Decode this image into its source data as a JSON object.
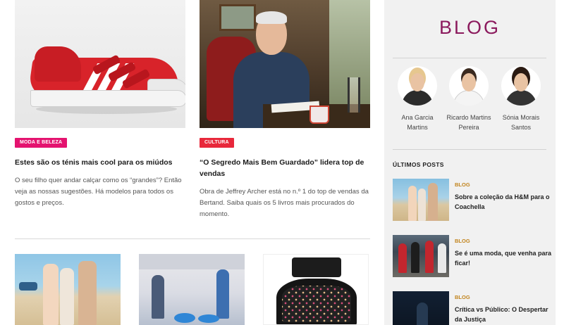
{
  "articles": [
    {
      "tag": "Moda e Beleza",
      "title": "Estes são os ténis mais cool para os miúdos",
      "excerpt": "O seu filho quer andar calçar como os “grandes”? Então veja as nossas sugestões. Há modelos para todos os gostos e preços.",
      "tag_color": "#e4136f"
    },
    {
      "tag": "Cultura",
      "title": "“O Segredo Mais Bem Guardado” lidera top de vendas",
      "excerpt": "Obra de Jeffrey Archer está no n.º 1 do top de vendas da Bertand. Saiba quais os 5 livros mais procurados do momento.",
      "tag_color": "#e8283b"
    }
  ],
  "sidebar": {
    "title": "BLOG",
    "title_color": "#8b1a5d",
    "authors": [
      {
        "name": "Ana Garcia Martins"
      },
      {
        "name": "Ricardo Martins Pereira"
      },
      {
        "name": "Sónia Morais Santos"
      }
    ],
    "latest_label": "ÚLTIMOS POSTS",
    "posts": [
      {
        "category": "BLOG",
        "title": "Sobre a coleção da H&M para o Coachella"
      },
      {
        "category": "BLOG",
        "title": "Se é uma moda, que venha para ficar!"
      },
      {
        "category": "BLOG",
        "title": "Crítica vs Público: O Despertar da Justiça"
      }
    ],
    "category_color": "#c2851e"
  }
}
